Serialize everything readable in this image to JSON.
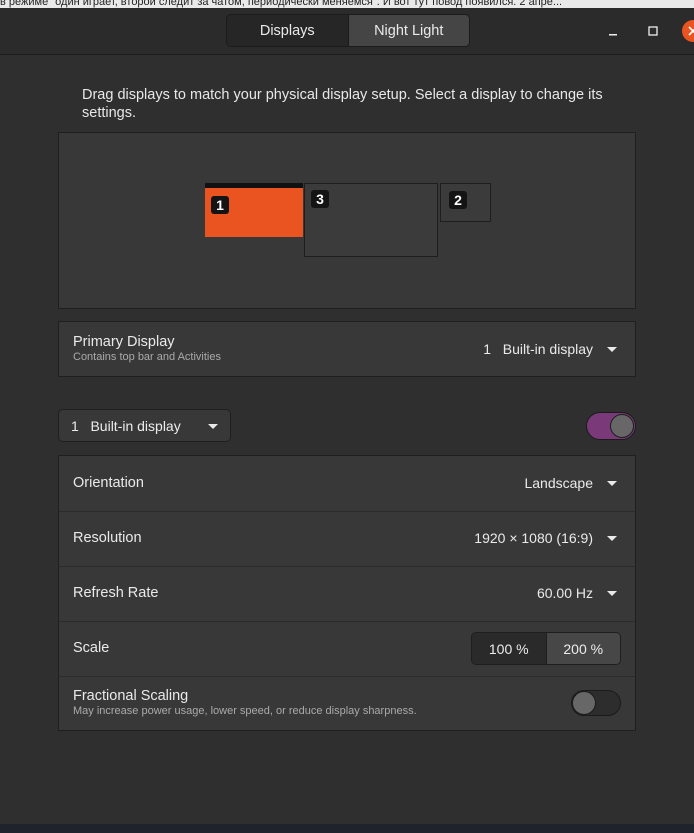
{
  "background_text": "в режиме \"один играет, второй следит за чатом, периодически меняемся\". И вот тут повод появился. 2 апре...",
  "header": {
    "tabs": [
      {
        "label": "Displays",
        "active": false
      },
      {
        "label": "Night Light",
        "active": true
      }
    ],
    "window_controls": [
      "minimize-icon",
      "maximize-icon",
      "close-icon"
    ]
  },
  "intro_text": "Drag displays to match your physical display setup. Select a display to change its settings.",
  "arrangement": {
    "monitors": [
      {
        "number": "1",
        "selected": true,
        "color": "#e95420"
      },
      {
        "number": "3",
        "selected": false
      },
      {
        "number": "2",
        "selected": false
      }
    ]
  },
  "primary_display": {
    "label": "Primary Display",
    "sublabel": "Contains top bar and Activities",
    "value": "1   Built-in display"
  },
  "display_selector": {
    "value": "1   Built-in display",
    "enabled": true,
    "toggle_color": "#7a3a7a"
  },
  "settings": {
    "orientation": {
      "label": "Orientation",
      "value": "Landscape"
    },
    "resolution": {
      "label": "Resolution",
      "value": "1920 × 1080 (16:9)"
    },
    "refresh_rate": {
      "label": "Refresh Rate",
      "value": "60.00 Hz"
    },
    "scale": {
      "label": "Scale",
      "options": [
        "100 %",
        "200 %"
      ],
      "selected": "100 %"
    },
    "fractional_scaling": {
      "label": "Fractional Scaling",
      "sublabel": "May increase power usage, lower speed, or reduce display sharpness.",
      "enabled": false
    }
  }
}
